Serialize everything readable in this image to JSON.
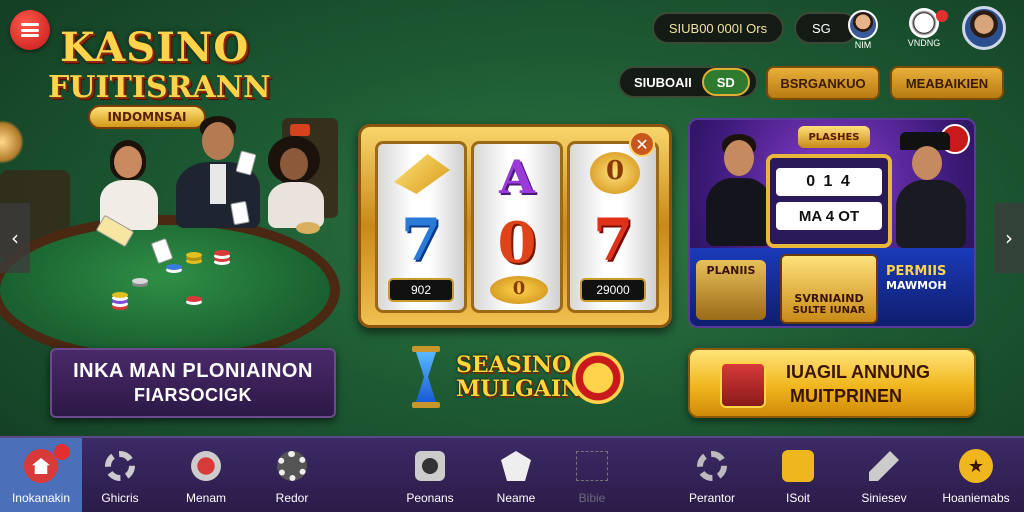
{
  "header": {
    "logo_line1": "KASINO",
    "logo_line2": "FUITISRANN",
    "logo_sub": "INDOMNSAI",
    "balance_pill": "SIUB00 000I Ors",
    "currency_pill": "SG",
    "profile_small_label": "NIM",
    "mascot_label": "VNDNG",
    "search_pill_label": "SIUBOAII",
    "search_toggle_value": "SD",
    "button_deposit": "BSRGANKUO",
    "button_membership": "MEABAIKIEN"
  },
  "left_panel": {
    "promo_line1": "INKA MAN PLONIAINON",
    "promo_line2": "FIARSOCIGK"
  },
  "slot_machine": {
    "reel1_display": "902",
    "reel3_display": "29000",
    "reel1_symbol": "7",
    "reel2_symbol_top": "A",
    "reel2_symbol_mid": "0",
    "reel2_symbol_bottom": "0",
    "reel3_symbol_top": "0",
    "reel3_symbol_mid": "7"
  },
  "center_logo": {
    "line1": "SEASINO",
    "line2": "MULGAIN"
  },
  "banner": {
    "badge": "PLASHES",
    "slot_row1": "0 1 4",
    "slot_row2": "MA 4 OT",
    "left_caption": "PLANIIS",
    "right_caption_title": "PERMIIS",
    "right_caption_sub": "MAWMOH",
    "center_caption1": "SVRNIAIND",
    "center_caption2": "SULTE IUNAR"
  },
  "cta": {
    "line1": "IUAGIL ANNUNG",
    "line2": "MUITPRINEN"
  },
  "bottom_nav": [
    {
      "label": "Inokanakin",
      "icon": "home-icon",
      "active": true
    },
    {
      "label": "Ghicris",
      "icon": "gear-icon",
      "active": false
    },
    {
      "label": "Menam",
      "icon": "chip-icon",
      "active": false
    },
    {
      "label": "Redor",
      "icon": "settings-icon",
      "active": false
    },
    {
      "label": "Peonans",
      "icon": "camera-icon",
      "active": false
    },
    {
      "label": "Neame",
      "icon": "shield-icon",
      "active": false
    },
    {
      "label": "Bibie",
      "icon": "placeholder-icon",
      "active": false
    },
    {
      "label": "Perantor",
      "icon": "cog-icon",
      "active": false
    },
    {
      "label": "ISoit",
      "icon": "wallet-icon",
      "active": false
    },
    {
      "label": "Siniesev",
      "icon": "pen-icon",
      "active": false
    },
    {
      "label": "Hoaniemabs",
      "icon": "star-badge-icon",
      "active": false
    }
  ],
  "colors": {
    "accent_gold": "#f0b61e",
    "brand_red": "#c3171b",
    "nav_bg": "#2a1c48",
    "nav_active": "#4b6fb8"
  }
}
